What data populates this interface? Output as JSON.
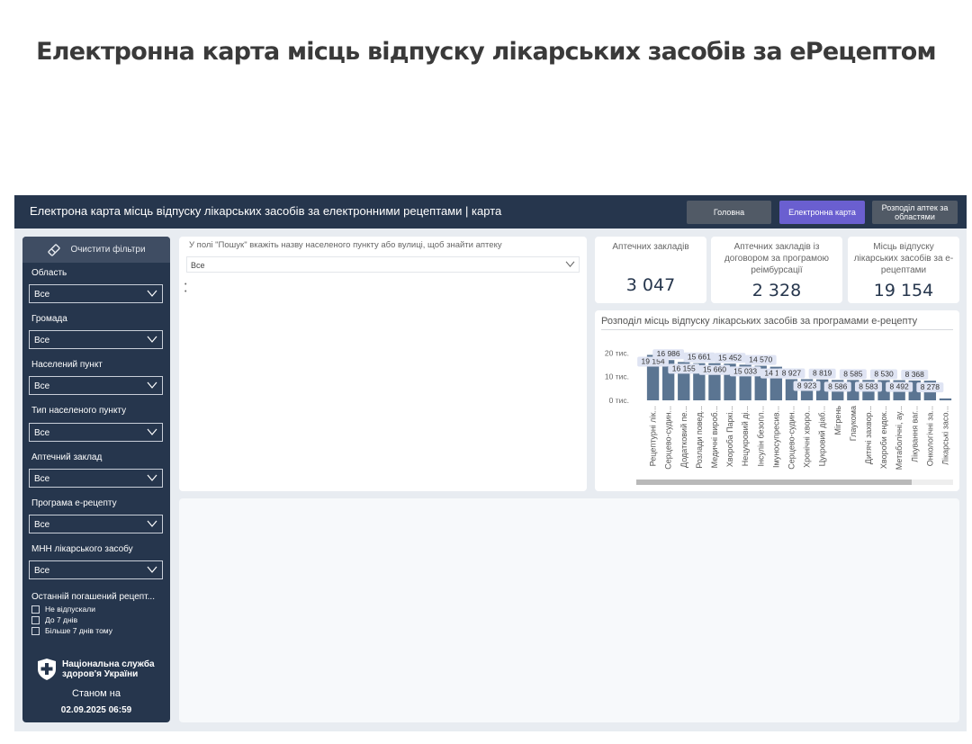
{
  "page": {
    "title": "Електронна карта місць відпуску лікарських засобів за еРецептом"
  },
  "topbar": {
    "title": "Електрона карта місць відпуску лікарських засобів за електронними рецептами | карта",
    "nav": {
      "home": "Головна",
      "map": "Електронна карта",
      "distribution": "Розподіл аптек за областями"
    },
    "colors": {
      "bar": "#26364d",
      "active": "#6a5fd0",
      "inactive": "#515a66"
    }
  },
  "sidebar": {
    "clear_filters": "Очистити фільтри",
    "filters": [
      {
        "label": "Область",
        "value": "Все"
      },
      {
        "label": "Громада",
        "value": "Все"
      },
      {
        "label": "Населений пункт",
        "value": "Все"
      },
      {
        "label": "Тип населеного пункту",
        "value": "Все"
      },
      {
        "label": "Аптечний заклад",
        "value": "Все"
      },
      {
        "label": "Програма е-рецепту",
        "value": "Все"
      },
      {
        "label": "МНН лікарського засобу",
        "value": "Все"
      }
    ],
    "last_redeemed": {
      "label": "Останній погашений рецепт...",
      "options": [
        "Не відпускали",
        "До 7 днів",
        "Більше 7 днів тому"
      ]
    },
    "logo": {
      "line1": "Національна служба",
      "line2": "здоров'я України"
    },
    "as_of_label": "Станом на",
    "as_of_value": "02.09.2025 06:59"
  },
  "search": {
    "hint": "У полі \"Пошук\" вкажіть назву населеного пункту або вулиці, щоб знайти аптеку",
    "value": "Все"
  },
  "kpis": [
    {
      "label": "Аптечних закладів",
      "value": "3 047"
    },
    {
      "label": "Аптечних закладів із договором за програмою реімбурсації",
      "value": "2 328"
    },
    {
      "label": "Місць відпуску лікарських засобів за е-рецептами",
      "value": "19 154"
    }
  ],
  "chart_data": {
    "type": "bar",
    "title": "Розподіл місць відпуску лікарських засобів за програмами е-рецепту",
    "xlabel": "",
    "ylabel": "",
    "ylim": [
      0,
      22000
    ],
    "yticks": [
      {
        "value": 0,
        "label": "0 тис."
      },
      {
        "value": 10000,
        "label": "10 тис."
      },
      {
        "value": 20000,
        "label": "20 тис."
      }
    ],
    "categories": [
      "Рецептурні лік...",
      "Серцево-судин...",
      "Додатковий пе...",
      "Розлади повед...",
      "Медичні вироб...",
      "Хвороба Паркі...",
      "Нецукровий ді...",
      "Інсулін безопл...",
      "Імуносупресив...",
      "Серцево-судин...",
      "Хронічні хворо...",
      "Цукровий діаб...",
      "Мігрень",
      "Глаукома",
      "Дитячі захвор...",
      "Хвороби ендок...",
      "Метаболічні, ау...",
      "Лікування ваг...",
      "Онкологічні за...",
      "Лікарські засо..."
    ],
    "values": [
      19154,
      16986,
      16155,
      15661,
      15660,
      15452,
      15033,
      14570,
      14171,
      8927,
      8923,
      8819,
      8586,
      8585,
      8583,
      8530,
      8492,
      8368,
      8278,
      800
    ],
    "data_labels": [
      "19 154",
      "16 986",
      "16 155",
      "15 661",
      "15 660",
      "15 452",
      "15 033",
      "14 570",
      "14 171",
      "8 927",
      "8 923",
      "8 819",
      "8 586",
      "8 585",
      "8 583",
      "8 530",
      "8 492",
      "8 368",
      "8 278",
      ""
    ],
    "bar_color": "#5b7592",
    "grid": false,
    "legend": "none"
  }
}
